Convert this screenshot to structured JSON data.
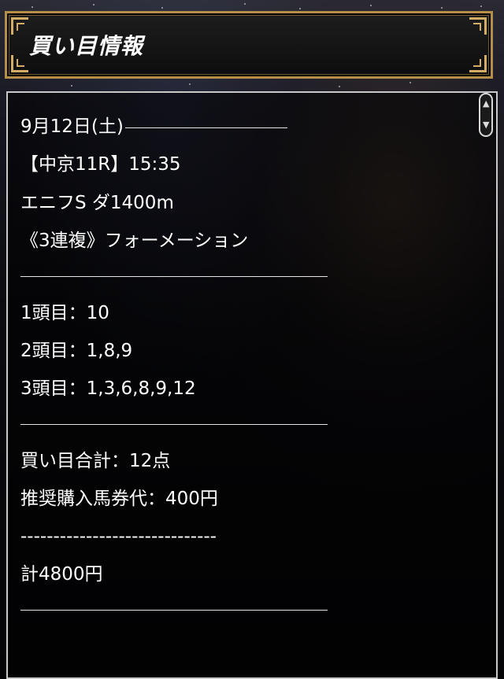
{
  "header": {
    "title": "買い目情報"
  },
  "race": {
    "date": "9月12日(土)",
    "venue_time": "【中京11R】15:35",
    "race_name": "エニフS ダ1400m",
    "bet_type": "《3連複》フォーメーション"
  },
  "selections": [
    {
      "label": "1頭目：10"
    },
    {
      "label": "2頭目：1,8,9"
    },
    {
      "label": "3頭目：1,3,6,8,9,12"
    }
  ],
  "summary": {
    "total_points": "買い目合計：12点",
    "stake": "推奨購入馬券代：400円",
    "dashes": "------------------------------",
    "total": "計4800円"
  },
  "colors": {
    "frame_gold": "#b58f4a",
    "text": "#ffffff",
    "box_border": "#c9c9c9"
  },
  "icons": {
    "scroll_up": "chevron-up-icon",
    "scroll_down": "chevron-down-icon"
  }
}
